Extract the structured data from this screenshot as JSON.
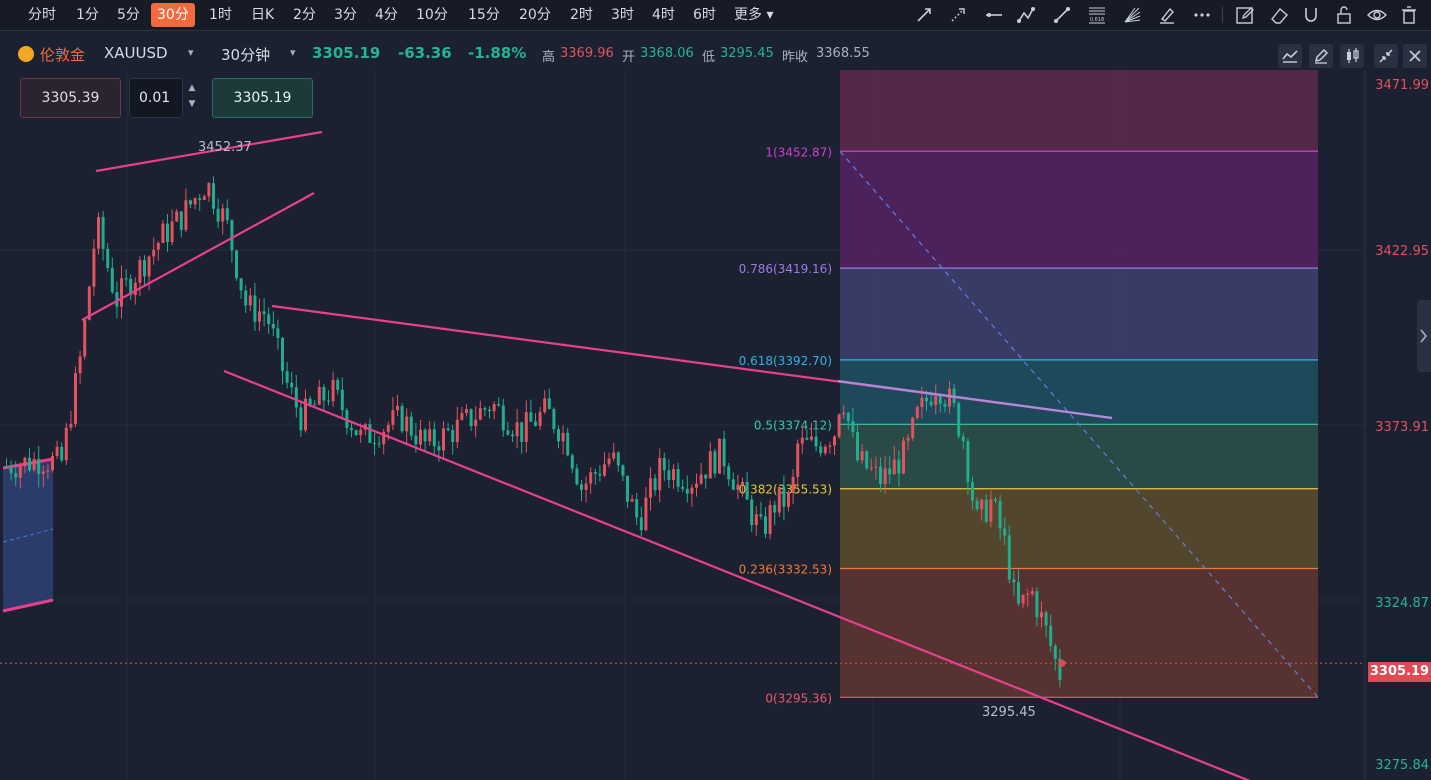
{
  "timeframes": [
    "分时",
    "1分",
    "5分",
    "30分",
    "1时",
    "日K",
    "2分",
    "3分",
    "4分",
    "10分",
    "15分",
    "20分",
    "2时",
    "3时",
    "4时",
    "6时",
    "更多"
  ],
  "active_timeframe": "30分",
  "toolbar_icons": [
    "trend-line-icon",
    "ray-icon",
    "horizontal-line-icon",
    "polyline-icon",
    "segment-icon",
    "fib-retracement-icon",
    "fib-fan-icon",
    "brush-icon",
    "more-dots-icon",
    "edit-icon",
    "eraser-icon",
    "magnet-icon",
    "lock-icon",
    "eye-icon",
    "delete-icon"
  ],
  "fib_tool_label": "0.618",
  "symbol": {
    "name": "伦敦金",
    "code": "XAUUSD",
    "interval": "30分钟",
    "price": "3305.19",
    "change": "-63.36",
    "change_pct": "-1.88%",
    "high_label": "高",
    "high": "3369.96",
    "open_label": "开",
    "open": "3368.06",
    "low_label": "低",
    "low": "3295.45",
    "prev_close_label": "昨收",
    "prev_close": "3368.55"
  },
  "order_panel": {
    "sell": "3305.39",
    "lot": "0.01",
    "buy": "3305.19"
  },
  "y_axis": {
    "ticks": [
      "3471.99",
      "3422.95",
      "3373.91",
      "3324.87",
      "3275.84"
    ],
    "current": "3305.19"
  },
  "fib_levels": [
    {
      "label": "1(3452.87)",
      "price": 3452.87,
      "line": "#d03fd0",
      "fill": "#5a2a6e"
    },
    {
      "label": "0.786(3419.16)",
      "price": 3419.16,
      "line": "#9b7be0",
      "fill": "#502361"
    },
    {
      "label": "0.618(3392.70)",
      "price": 3392.7,
      "line": "#2fb3e6",
      "fill": "#3b3e6a"
    },
    {
      "label": "0.5(3374.12)",
      "price": 3374.12,
      "line": "#38c9a6",
      "fill": "#1e4d60"
    },
    {
      "label": "0.382(3355.53)",
      "price": 3355.53,
      "line": "#e7c63a",
      "fill": "#2a4e4a"
    },
    {
      "label": "0.236(3332.53)",
      "price": 3332.53,
      "line": "#f07a3a",
      "fill": "#574a2c"
    },
    {
      "label": "0(3295.36)",
      "price": 3295.36,
      "line": "#e85a6a",
      "fill": "#5b3432"
    }
  ],
  "fib_top_band_fill": "#5a2a4a",
  "annotations": {
    "high_mark": "3452.37",
    "low_mark": "3295.45"
  },
  "colors": {
    "up": "#e0535f",
    "down": "#22ad8e",
    "trendline": "#e8408e",
    "accent": "#f26a3d"
  }
}
